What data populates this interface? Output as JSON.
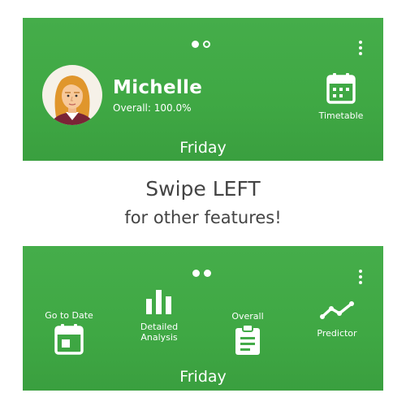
{
  "top_panel": {
    "page_indicator": "1 of 2",
    "user_name": "Michelle",
    "overall": "Overall: 100.0%",
    "timetable_label": "Timetable",
    "day": "Friday"
  },
  "caption": {
    "line1": "Swipe LEFT",
    "line2": "for other features!"
  },
  "bottom_panel": {
    "page_indicator": "2 of 2",
    "features": {
      "go_to_date": "Go to Date",
      "detailed_line1": "Detailed",
      "detailed_line2": "Analysis",
      "overall": "Overall",
      "predictor": "Predictor"
    },
    "day": "Friday"
  },
  "icons": {
    "more": "more-vert-icon",
    "calendar": "calendar-icon",
    "bar_chart": "bar-chart-icon",
    "clipboard": "clipboard-icon",
    "trend": "trend-line-icon"
  },
  "colors": {
    "panel_green": "#43ab48",
    "caption_text": "#444444",
    "white": "#ffffff"
  }
}
